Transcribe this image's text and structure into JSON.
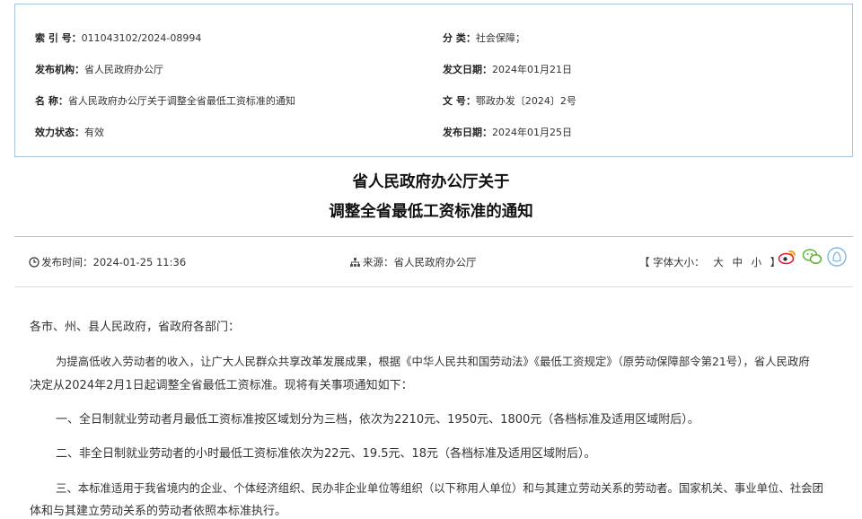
{
  "meta": {
    "index_label": "索 引 号：",
    "index_value": "011043102/2024-08994",
    "category_label": "分    类：",
    "category_value": "社会保障；",
    "issuer_label": "发布机构：",
    "issuer_value": "省人民政府办公厅",
    "issue_date_label": "发文日期：",
    "issue_date_value": "2024年01月21日",
    "name_label": "名    称：",
    "name_value": "省人民政府办公厅关于调整全省最低工资标准的通知",
    "doc_no_label": "文    号：",
    "doc_no_value": "鄂政办发〔2024〕2号",
    "status_label": "效力状态：",
    "status_value": "有效",
    "publish_date_label": "发布日期：",
    "publish_date_value": "2024年01月25日"
  },
  "article": {
    "title_line1": "省人民政府办公厅关于",
    "title_line2": "调整全省最低工资标准的通知"
  },
  "info_bar": {
    "publish_time_label": "发布时间：",
    "publish_time_value": "2024-01-25 11:36",
    "source_label": "来源：",
    "source_value": "省人民政府办公厅",
    "font_size_open": "【 字体大小：",
    "font_large": "大",
    "font_medium": "中",
    "font_small": "小",
    "font_size_close": "】"
  },
  "share_icons": [
    "weibo-icon",
    "wechat-icon",
    "qq-icon"
  ],
  "colors": {
    "border": "#a8c3df",
    "weibo": "#e6162d",
    "wechat": "#5fb336",
    "qq": "#7fb7e3"
  },
  "body": {
    "salutation": "各市、州、县人民政府，省政府各部门：",
    "p1_line1": "为提高低收入劳动者的收入，让广大人民群众共享改革发展成果，根据《中华人民共和国劳动法》《最低工资规定》（原劳动保障部令第21号），省人民政府",
    "p1_line2": "决定从2024年2月1日起调整全省最低工资标准。现将有关事项通知如下：",
    "p2": "一、全日制就业劳动者月最低工资标准按区域划分为三档，依次为2210元、1950元、1800元（各档标准及适用区域附后）。",
    "p3": "二、非全日制就业劳动者的小时最低工资标准依次为22元、19.5元、18元（各档标准及适用区域附后）。",
    "p4_line1": "三、本标准适用于我省境内的企业、个体经济组织、民办非企业单位等组织（以下称用人单位）和与其建立劳动关系的劳动者。国家机关、事业单位、社会团",
    "p4_line2": "体和与其建立劳动关系的劳动者依照本标准执行。"
  }
}
